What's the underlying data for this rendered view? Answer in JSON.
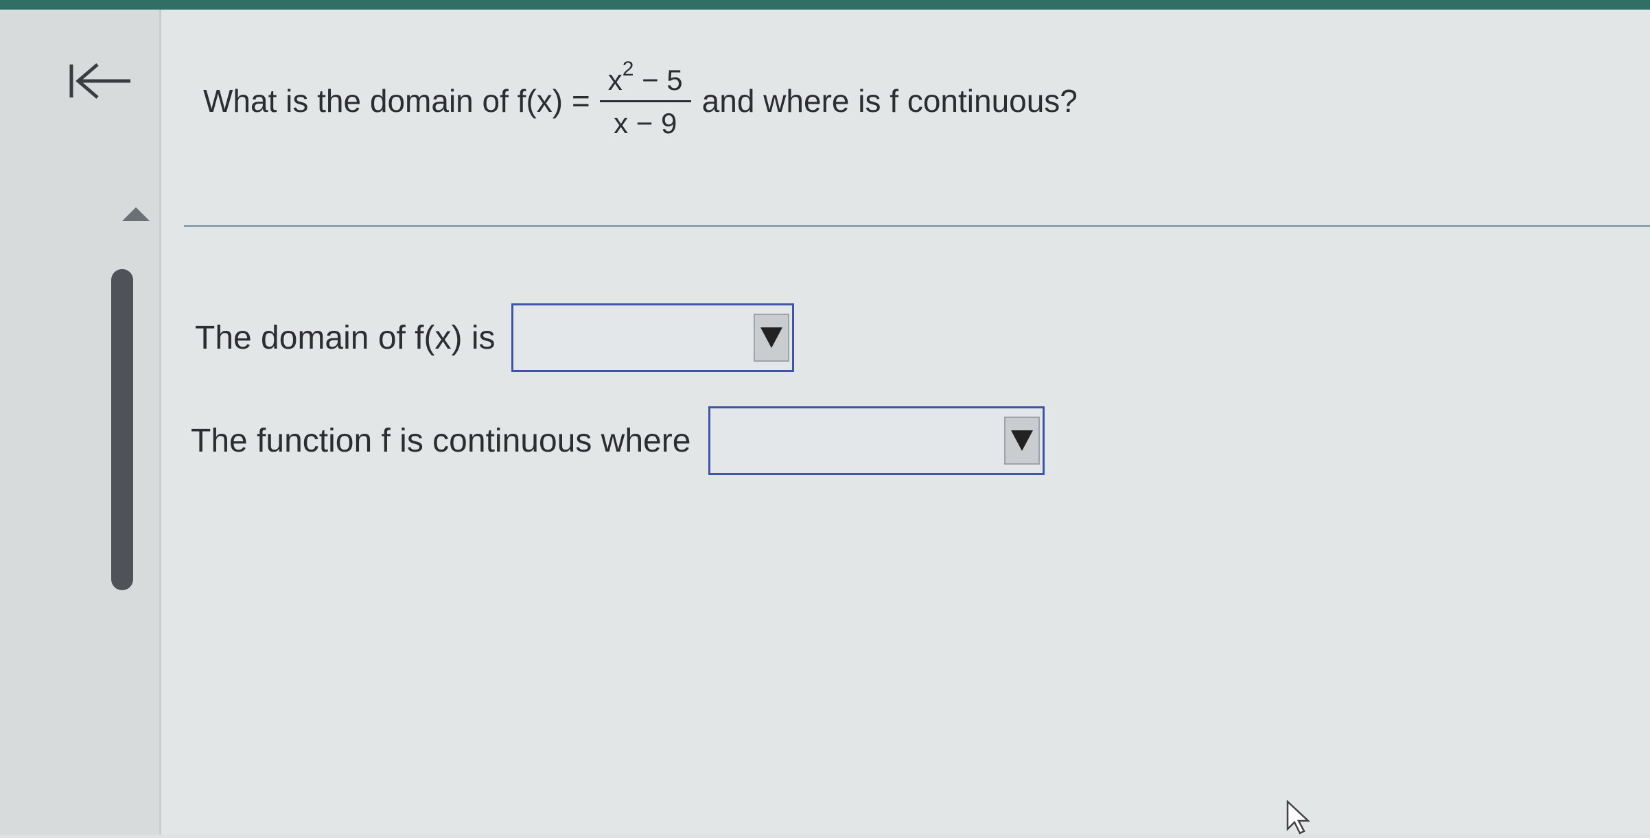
{
  "question": {
    "prefix": "What is the domain of f(x) =",
    "numerator_base": "x",
    "numerator_exp": "2",
    "numerator_rest": " − 5",
    "denominator": "x − 9",
    "suffix": "and where is f continuous?"
  },
  "answers": [
    {
      "label": "The domain of f(x) is",
      "value": ""
    },
    {
      "label": "The function f is continuous where",
      "value": ""
    }
  ],
  "icons": {
    "back": "back-to-start-icon",
    "scroll_up": "triangle-up-icon",
    "dropdown": "triangle-down-icon",
    "cursor": "mouse-pointer-icon"
  },
  "colors": {
    "top_bar": "#2f6f66",
    "dropdown_border": "#3f56a6",
    "scroll_thumb": "#4f5358"
  }
}
